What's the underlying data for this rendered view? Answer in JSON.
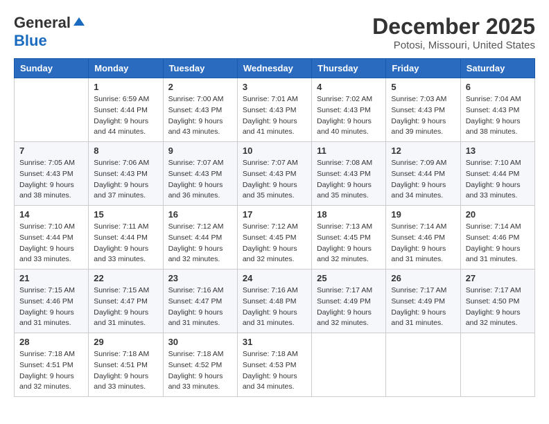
{
  "header": {
    "logo_general": "General",
    "logo_blue": "Blue",
    "month_title": "December 2025",
    "location": "Potosi, Missouri, United States"
  },
  "days_of_week": [
    "Sunday",
    "Monday",
    "Tuesday",
    "Wednesday",
    "Thursday",
    "Friday",
    "Saturday"
  ],
  "weeks": [
    [
      {
        "day": "",
        "sunrise": "",
        "sunset": "",
        "daylight": ""
      },
      {
        "day": "1",
        "sunrise": "Sunrise: 6:59 AM",
        "sunset": "Sunset: 4:44 PM",
        "daylight": "Daylight: 9 hours and 44 minutes."
      },
      {
        "day": "2",
        "sunrise": "Sunrise: 7:00 AM",
        "sunset": "Sunset: 4:43 PM",
        "daylight": "Daylight: 9 hours and 43 minutes."
      },
      {
        "day": "3",
        "sunrise": "Sunrise: 7:01 AM",
        "sunset": "Sunset: 4:43 PM",
        "daylight": "Daylight: 9 hours and 41 minutes."
      },
      {
        "day": "4",
        "sunrise": "Sunrise: 7:02 AM",
        "sunset": "Sunset: 4:43 PM",
        "daylight": "Daylight: 9 hours and 40 minutes."
      },
      {
        "day": "5",
        "sunrise": "Sunrise: 7:03 AM",
        "sunset": "Sunset: 4:43 PM",
        "daylight": "Daylight: 9 hours and 39 minutes."
      },
      {
        "day": "6",
        "sunrise": "Sunrise: 7:04 AM",
        "sunset": "Sunset: 4:43 PM",
        "daylight": "Daylight: 9 hours and 38 minutes."
      }
    ],
    [
      {
        "day": "7",
        "sunrise": "Sunrise: 7:05 AM",
        "sunset": "Sunset: 4:43 PM",
        "daylight": "Daylight: 9 hours and 38 minutes."
      },
      {
        "day": "8",
        "sunrise": "Sunrise: 7:06 AM",
        "sunset": "Sunset: 4:43 PM",
        "daylight": "Daylight: 9 hours and 37 minutes."
      },
      {
        "day": "9",
        "sunrise": "Sunrise: 7:07 AM",
        "sunset": "Sunset: 4:43 PM",
        "daylight": "Daylight: 9 hours and 36 minutes."
      },
      {
        "day": "10",
        "sunrise": "Sunrise: 7:07 AM",
        "sunset": "Sunset: 4:43 PM",
        "daylight": "Daylight: 9 hours and 35 minutes."
      },
      {
        "day": "11",
        "sunrise": "Sunrise: 7:08 AM",
        "sunset": "Sunset: 4:43 PM",
        "daylight": "Daylight: 9 hours and 35 minutes."
      },
      {
        "day": "12",
        "sunrise": "Sunrise: 7:09 AM",
        "sunset": "Sunset: 4:44 PM",
        "daylight": "Daylight: 9 hours and 34 minutes."
      },
      {
        "day": "13",
        "sunrise": "Sunrise: 7:10 AM",
        "sunset": "Sunset: 4:44 PM",
        "daylight": "Daylight: 9 hours and 33 minutes."
      }
    ],
    [
      {
        "day": "14",
        "sunrise": "Sunrise: 7:10 AM",
        "sunset": "Sunset: 4:44 PM",
        "daylight": "Daylight: 9 hours and 33 minutes."
      },
      {
        "day": "15",
        "sunrise": "Sunrise: 7:11 AM",
        "sunset": "Sunset: 4:44 PM",
        "daylight": "Daylight: 9 hours and 33 minutes."
      },
      {
        "day": "16",
        "sunrise": "Sunrise: 7:12 AM",
        "sunset": "Sunset: 4:44 PM",
        "daylight": "Daylight: 9 hours and 32 minutes."
      },
      {
        "day": "17",
        "sunrise": "Sunrise: 7:12 AM",
        "sunset": "Sunset: 4:45 PM",
        "daylight": "Daylight: 9 hours and 32 minutes."
      },
      {
        "day": "18",
        "sunrise": "Sunrise: 7:13 AM",
        "sunset": "Sunset: 4:45 PM",
        "daylight": "Daylight: 9 hours and 32 minutes."
      },
      {
        "day": "19",
        "sunrise": "Sunrise: 7:14 AM",
        "sunset": "Sunset: 4:46 PM",
        "daylight": "Daylight: 9 hours and 31 minutes."
      },
      {
        "day": "20",
        "sunrise": "Sunrise: 7:14 AM",
        "sunset": "Sunset: 4:46 PM",
        "daylight": "Daylight: 9 hours and 31 minutes."
      }
    ],
    [
      {
        "day": "21",
        "sunrise": "Sunrise: 7:15 AM",
        "sunset": "Sunset: 4:46 PM",
        "daylight": "Daylight: 9 hours and 31 minutes."
      },
      {
        "day": "22",
        "sunrise": "Sunrise: 7:15 AM",
        "sunset": "Sunset: 4:47 PM",
        "daylight": "Daylight: 9 hours and 31 minutes."
      },
      {
        "day": "23",
        "sunrise": "Sunrise: 7:16 AM",
        "sunset": "Sunset: 4:47 PM",
        "daylight": "Daylight: 9 hours and 31 minutes."
      },
      {
        "day": "24",
        "sunrise": "Sunrise: 7:16 AM",
        "sunset": "Sunset: 4:48 PM",
        "daylight": "Daylight: 9 hours and 31 minutes."
      },
      {
        "day": "25",
        "sunrise": "Sunrise: 7:17 AM",
        "sunset": "Sunset: 4:49 PM",
        "daylight": "Daylight: 9 hours and 32 minutes."
      },
      {
        "day": "26",
        "sunrise": "Sunrise: 7:17 AM",
        "sunset": "Sunset: 4:49 PM",
        "daylight": "Daylight: 9 hours and 31 minutes."
      },
      {
        "day": "27",
        "sunrise": "Sunrise: 7:17 AM",
        "sunset": "Sunset: 4:50 PM",
        "daylight": "Daylight: 9 hours and 32 minutes."
      }
    ],
    [
      {
        "day": "28",
        "sunrise": "Sunrise: 7:18 AM",
        "sunset": "Sunset: 4:51 PM",
        "daylight": "Daylight: 9 hours and 32 minutes."
      },
      {
        "day": "29",
        "sunrise": "Sunrise: 7:18 AM",
        "sunset": "Sunset: 4:51 PM",
        "daylight": "Daylight: 9 hours and 33 minutes."
      },
      {
        "day": "30",
        "sunrise": "Sunrise: 7:18 AM",
        "sunset": "Sunset: 4:52 PM",
        "daylight": "Daylight: 9 hours and 33 minutes."
      },
      {
        "day": "31",
        "sunrise": "Sunrise: 7:18 AM",
        "sunset": "Sunset: 4:53 PM",
        "daylight": "Daylight: 9 hours and 34 minutes."
      },
      {
        "day": "",
        "sunrise": "",
        "sunset": "",
        "daylight": ""
      },
      {
        "day": "",
        "sunrise": "",
        "sunset": "",
        "daylight": ""
      },
      {
        "day": "",
        "sunrise": "",
        "sunset": "",
        "daylight": ""
      }
    ]
  ]
}
